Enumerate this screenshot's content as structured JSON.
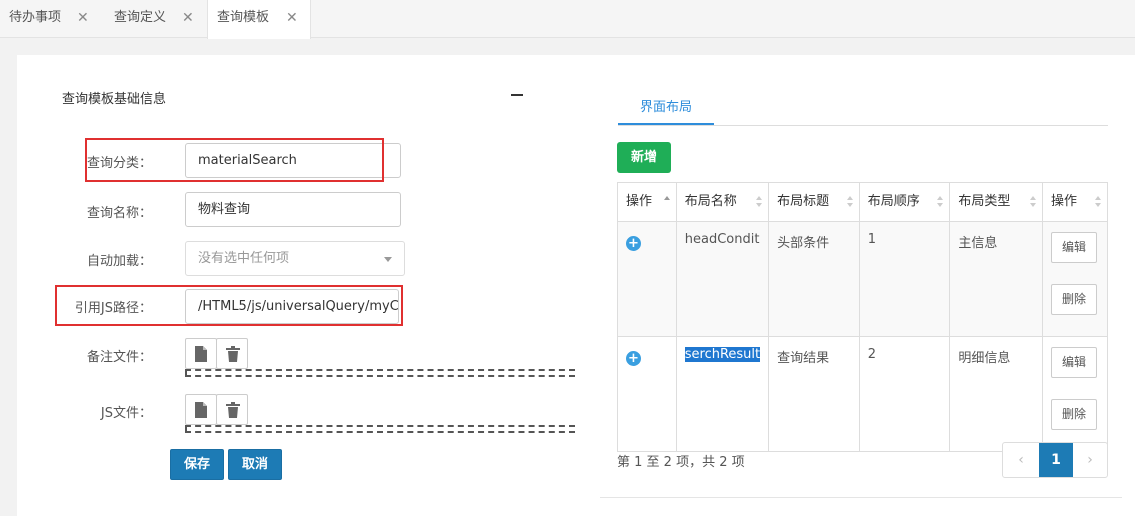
{
  "tabs": [
    {
      "label": "待办事项",
      "close": "✕"
    },
    {
      "label": "查询定义",
      "close": "✕"
    },
    {
      "label": "查询模板",
      "close": "✕"
    }
  ],
  "form": {
    "section_title": "查询模板基础信息",
    "collapse_symbol": "—",
    "category_label": "查询分类：",
    "category_value": "materialSearch",
    "name_label": "查询名称：",
    "name_value": "物料查询",
    "autoload_label": "自动加载：",
    "autoload_placeholder": "没有选中任何项",
    "jspath_label": "引用JS路径：",
    "jspath_value": "/HTML5/js/universalQuery/myC",
    "note_file_label": "备注文件：",
    "js_file_label": "JS文件：",
    "save_label": "保存",
    "cancel_label": "取消"
  },
  "layout": {
    "tab_label": "界面布局",
    "add_label": "新增",
    "columns": [
      "操作",
      "布局名称",
      "布局标题",
      "布局顺序",
      "布局类型",
      "操作"
    ],
    "rows": [
      {
        "name": "headCondit",
        "title": "头部条件",
        "order": "1",
        "type": "主信息",
        "edit": "编辑",
        "delete": "删除"
      },
      {
        "name": "serchResult",
        "title": "查询结果",
        "order": "2",
        "type": "明细信息",
        "edit": "编辑",
        "delete": "删除"
      }
    ],
    "pager_info": "第 1 至 2 项，共 2 项",
    "pager_prev": "‹",
    "pager_current": "1",
    "pager_next": "›"
  },
  "colors": {
    "primary": "#1d7bb5",
    "success": "#1fae57",
    "highlight": "#e03030"
  }
}
